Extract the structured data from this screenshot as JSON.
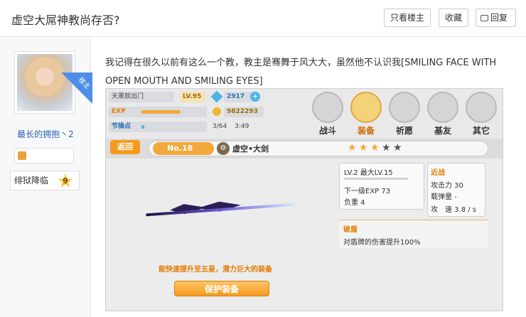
{
  "header": {
    "title": "虚空大屌神教尚存否?",
    "btn_only_op": "只看楼主",
    "btn_favorite": "收藏",
    "btn_reply": "回复",
    "reply_icon": "comment-icon"
  },
  "author": {
    "corner_tag": "楼主",
    "name": "最长的拥抱丶2",
    "level_icon": "level-icon",
    "forum_rank": "绯狱降临",
    "forum_level": "9"
  },
  "post": {
    "text": "我记得在很久以前有这么一个教，教主是骞舞于风大大，虽然他不认识我[SMILING FACE WITH OPEN MOUTH AND SMILING EYES]"
  },
  "game": {
    "player_name": "天黑就出门",
    "level_label": "LV.95",
    "gems": "2917",
    "gold": "9822293",
    "exp_label": "EXP",
    "exp_progress": 0.62,
    "stamina_label": "节操点",
    "stamina_value": "3/64",
    "stamina_timer": "3:49",
    "stamina_progress": 0.05,
    "menu": [
      {
        "label": "战斗",
        "active": false
      },
      {
        "label": "装备",
        "active": true
      },
      {
        "label": "祈愿",
        "active": false
      },
      {
        "label": "基友",
        "active": false
      },
      {
        "label": "其它",
        "active": false
      }
    ],
    "back_label": "返回",
    "number_label": "No.18",
    "weapon_name": "虚空•大剑",
    "stars_total": 5,
    "stars_filled": 3,
    "lv_info": "LV.2 最大LV.15",
    "next_exp": "下一级EXP 73",
    "load": "负重 4",
    "type_label": "近战",
    "attack": "攻击力 30",
    "ammo": "载弹量 -",
    "attack_speed": "攻　速 3.8 / s",
    "skill_name": "破盾",
    "skill_desc": "对盾牌的伤害提升100%",
    "hint": "能快速提升至五星，潜力巨大的装备",
    "protect_label": "保护装备",
    "colors": {
      "accent": "#f39b1f",
      "active": "#c96b00"
    }
  }
}
